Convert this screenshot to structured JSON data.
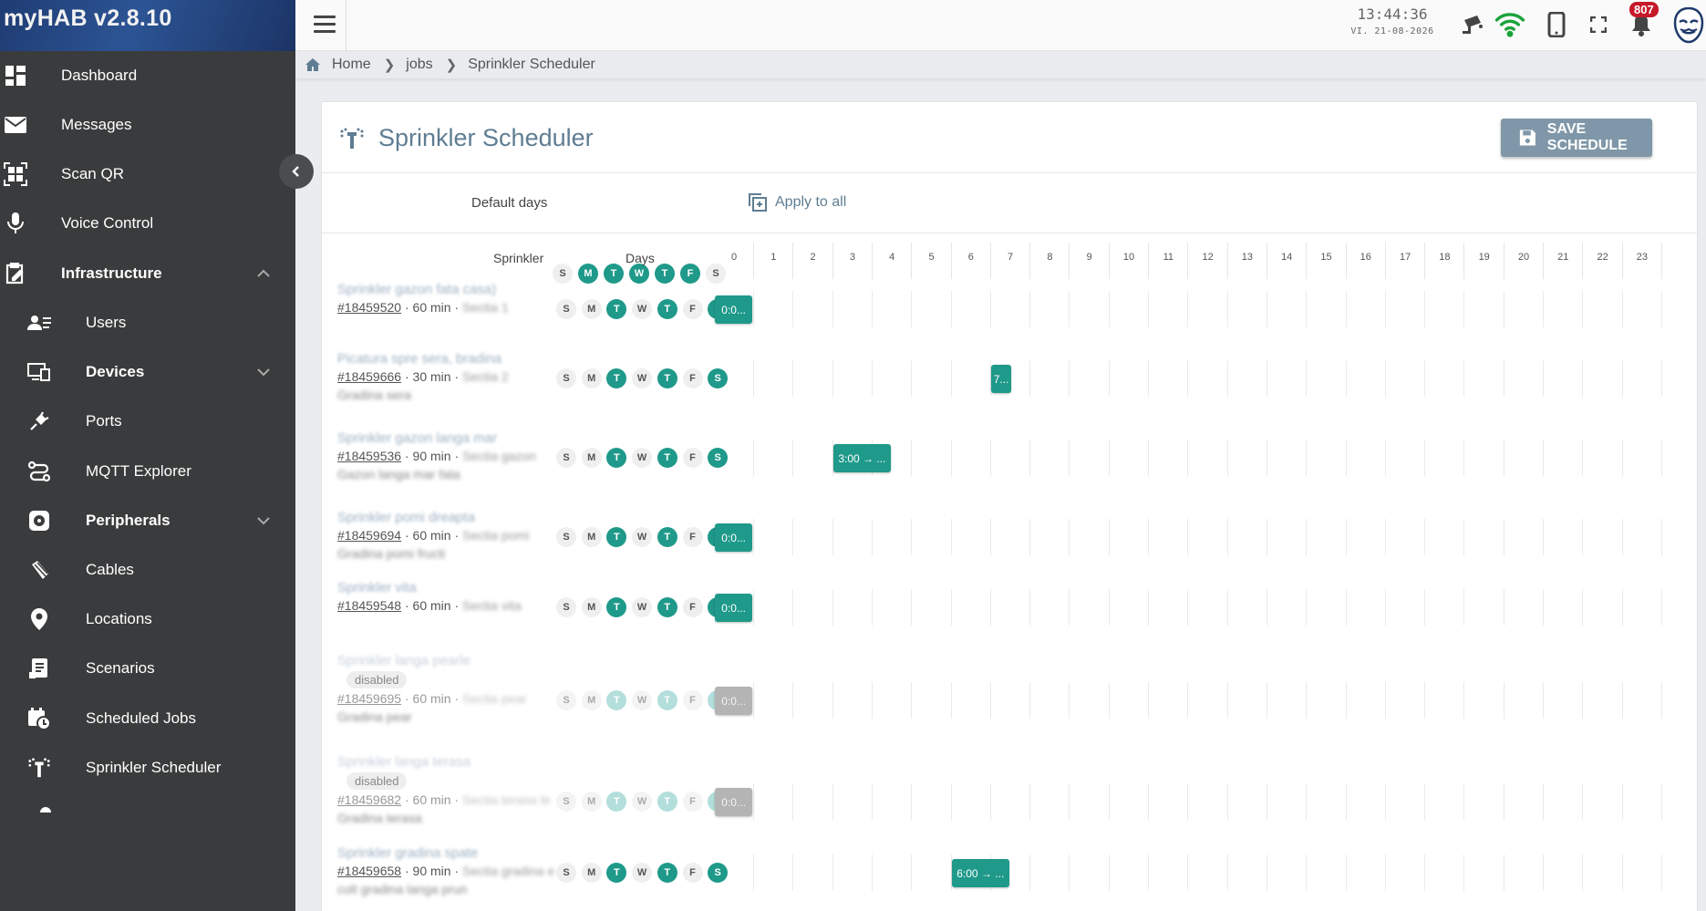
{
  "app": {
    "title": "myHAB v2.8.10"
  },
  "sidebar": {
    "items": [
      {
        "label": "Dashboard",
        "icon": "dashboard-icon"
      },
      {
        "label": "Messages",
        "icon": "envelope-icon"
      },
      {
        "label": "Scan QR",
        "icon": "qr-code-icon"
      },
      {
        "label": "Voice Control",
        "icon": "microphone-icon"
      },
      {
        "label": "Infrastructure",
        "icon": "clipboard-edit-icon"
      },
      {
        "label": "Users",
        "icon": "users-icon"
      },
      {
        "label": "Devices",
        "icon": "devices-icon"
      },
      {
        "label": "Ports",
        "icon": "plug-icon"
      },
      {
        "label": "MQTT Explorer",
        "icon": "route-icon"
      },
      {
        "label": "Peripherals",
        "icon": "peripherals-icon"
      },
      {
        "label": "Cables",
        "icon": "cable-icon"
      },
      {
        "label": "Locations",
        "icon": "location-pin-icon"
      },
      {
        "label": "Scenarios",
        "icon": "scenario-icon"
      },
      {
        "label": "Scheduled Jobs",
        "icon": "calendar-clock-icon"
      },
      {
        "label": "Sprinkler Scheduler",
        "icon": "sprinkler-icon"
      }
    ]
  },
  "topbar": {
    "time": "13:44:36",
    "date": "VI. 21-08-2026",
    "notification_count": "807"
  },
  "breadcrumb": {
    "home": "Home",
    "jobs": "jobs",
    "current": "Sprinkler Scheduler"
  },
  "page": {
    "title": "Sprinkler Scheduler",
    "save_label": "SAVE SCHEDULE",
    "default_days_label": "Default days",
    "apply_all_label": "Apply to all",
    "col_sprinkler": "Sprinkler",
    "col_days": "Days",
    "disabled_label": "disabled"
  },
  "default_days": [
    {
      "l": "S",
      "on": false
    },
    {
      "l": "M",
      "on": true
    },
    {
      "l": "T",
      "on": true
    },
    {
      "l": "W",
      "on": true
    },
    {
      "l": "T",
      "on": true
    },
    {
      "l": "F",
      "on": true
    },
    {
      "l": "S",
      "on": false
    }
  ],
  "hours": [
    "0",
    "1",
    "2",
    "3",
    "4",
    "5",
    "6",
    "7",
    "8",
    "9",
    "10",
    "11",
    "12",
    "13",
    "14",
    "15",
    "16",
    "17",
    "18",
    "19",
    "20",
    "21",
    "22",
    "23"
  ],
  "rows": [
    {
      "name": "Sprinkler gazon fata casa)",
      "id": "#18459520",
      "duration": "60 min",
      "extra_meta": "Sectia 1",
      "extra_line": "",
      "disabled": false,
      "days": [
        false,
        false,
        true,
        false,
        true,
        false,
        true
      ],
      "slot": {
        "hour": 0,
        "span": 1,
        "label": "0:0..."
      }
    },
    {
      "name": "Picatura spre sera, bradina",
      "id": "#18459666",
      "duration": "30 min",
      "extra_meta": "Sectia 2",
      "extra_line": "Gradina sera",
      "disabled": false,
      "days": [
        false,
        false,
        true,
        false,
        true,
        false,
        true
      ],
      "slot": {
        "hour": 7,
        "span": 0.5,
        "label": "7..."
      }
    },
    {
      "name": "Sprinkler gazon langa mar",
      "id": "#18459536",
      "duration": "90 min",
      "extra_meta": "Sectia gazon",
      "extra_line": "Gazon langa mar fata",
      "disabled": false,
      "days": [
        false,
        false,
        true,
        false,
        true,
        false,
        true
      ],
      "slot": {
        "hour": 3,
        "span": 1.5,
        "label": "3:00 → ..."
      }
    },
    {
      "name": "Sprinkler pomi dreapta",
      "id": "#18459694",
      "duration": "60 min",
      "extra_meta": "Sectia pomi",
      "extra_line": "Gradina pomi fructi",
      "disabled": false,
      "days": [
        false,
        false,
        true,
        false,
        true,
        false,
        true
      ],
      "slot": {
        "hour": 0,
        "span": 1,
        "label": "0:0..."
      }
    },
    {
      "name": "Sprinkler vita",
      "id": "#18459548",
      "duration": "60 min",
      "extra_meta": "Sectia vita",
      "extra_line": "",
      "disabled": false,
      "days": [
        false,
        false,
        true,
        false,
        true,
        false,
        true
      ],
      "slot": {
        "hour": 0,
        "span": 1,
        "label": "0:0..."
      }
    },
    {
      "name": "Sprinkler langa pearle",
      "id": "#18459695",
      "duration": "60 min",
      "extra_meta": "Sectia pear",
      "extra_line": "Gradina pear",
      "disabled": true,
      "days": [
        false,
        false,
        true,
        false,
        true,
        false,
        true
      ],
      "slot": {
        "hour": 0,
        "span": 1,
        "label": "0:0..."
      }
    },
    {
      "name": "Sprinkler langa terasa",
      "id": "#18459682",
      "duration": "60 min",
      "extra_meta": "Sectia terasa le",
      "extra_line": "Gradina terasa",
      "disabled": true,
      "days": [
        false,
        false,
        true,
        false,
        true,
        false,
        true
      ],
      "slot": {
        "hour": 0,
        "span": 1,
        "label": "0:0..."
      }
    },
    {
      "name": "Sprinkler gradina spate",
      "id": "#18459658",
      "duration": "90 min",
      "extra_meta": "Sectia gradina e",
      "extra_line": "colt gradina langa prun",
      "disabled": false,
      "days": [
        false,
        false,
        true,
        false,
        true,
        false,
        true
      ],
      "slot": {
        "hour": 6,
        "span": 1.5,
        "label": "6:00 → ..."
      }
    }
  ]
}
